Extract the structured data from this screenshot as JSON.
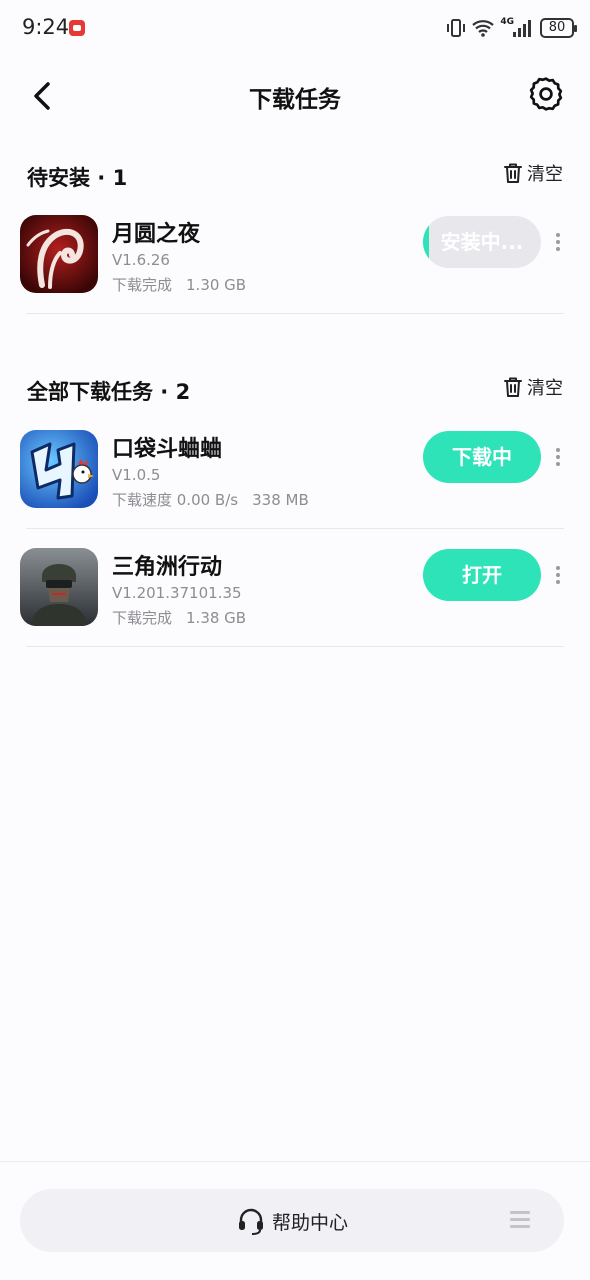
{
  "status_bar": {
    "time": "9:24",
    "network": "4G",
    "battery": "80"
  },
  "header": {
    "title": "下载任务",
    "back_icon": "back-arrow-icon",
    "settings_icon": "gear-icon"
  },
  "pending_section": {
    "title": "待安装 · 1",
    "clear_label": "清空"
  },
  "pending_items": [
    {
      "name": "月圆之夜",
      "version": "V1.6.26",
      "status": "下载完成",
      "size": "1.30 GB",
      "action": "安装中...",
      "install_progress": 0.05
    }
  ],
  "all_section": {
    "title": "全部下载任务 · 2",
    "clear_label": "清空"
  },
  "all_items": [
    {
      "name": "口袋斗蛐蛐",
      "version": "V1.0.5",
      "status": "下载速度 0.00 B/s",
      "size": "338 MB",
      "action": "下载中"
    },
    {
      "name": "三角洲行动",
      "version": "V1.201.37101.35",
      "status": "下载完成",
      "size": "1.38 GB",
      "action": "打开"
    }
  ],
  "footer": {
    "help_label": "帮助中心",
    "help_icon": "headset-icon",
    "menu_icon": "menu-icon"
  },
  "colors": {
    "accent": "#2ee3b8",
    "installing_bg": "#e7e7ec",
    "secondary_text": "#8d8d92"
  }
}
